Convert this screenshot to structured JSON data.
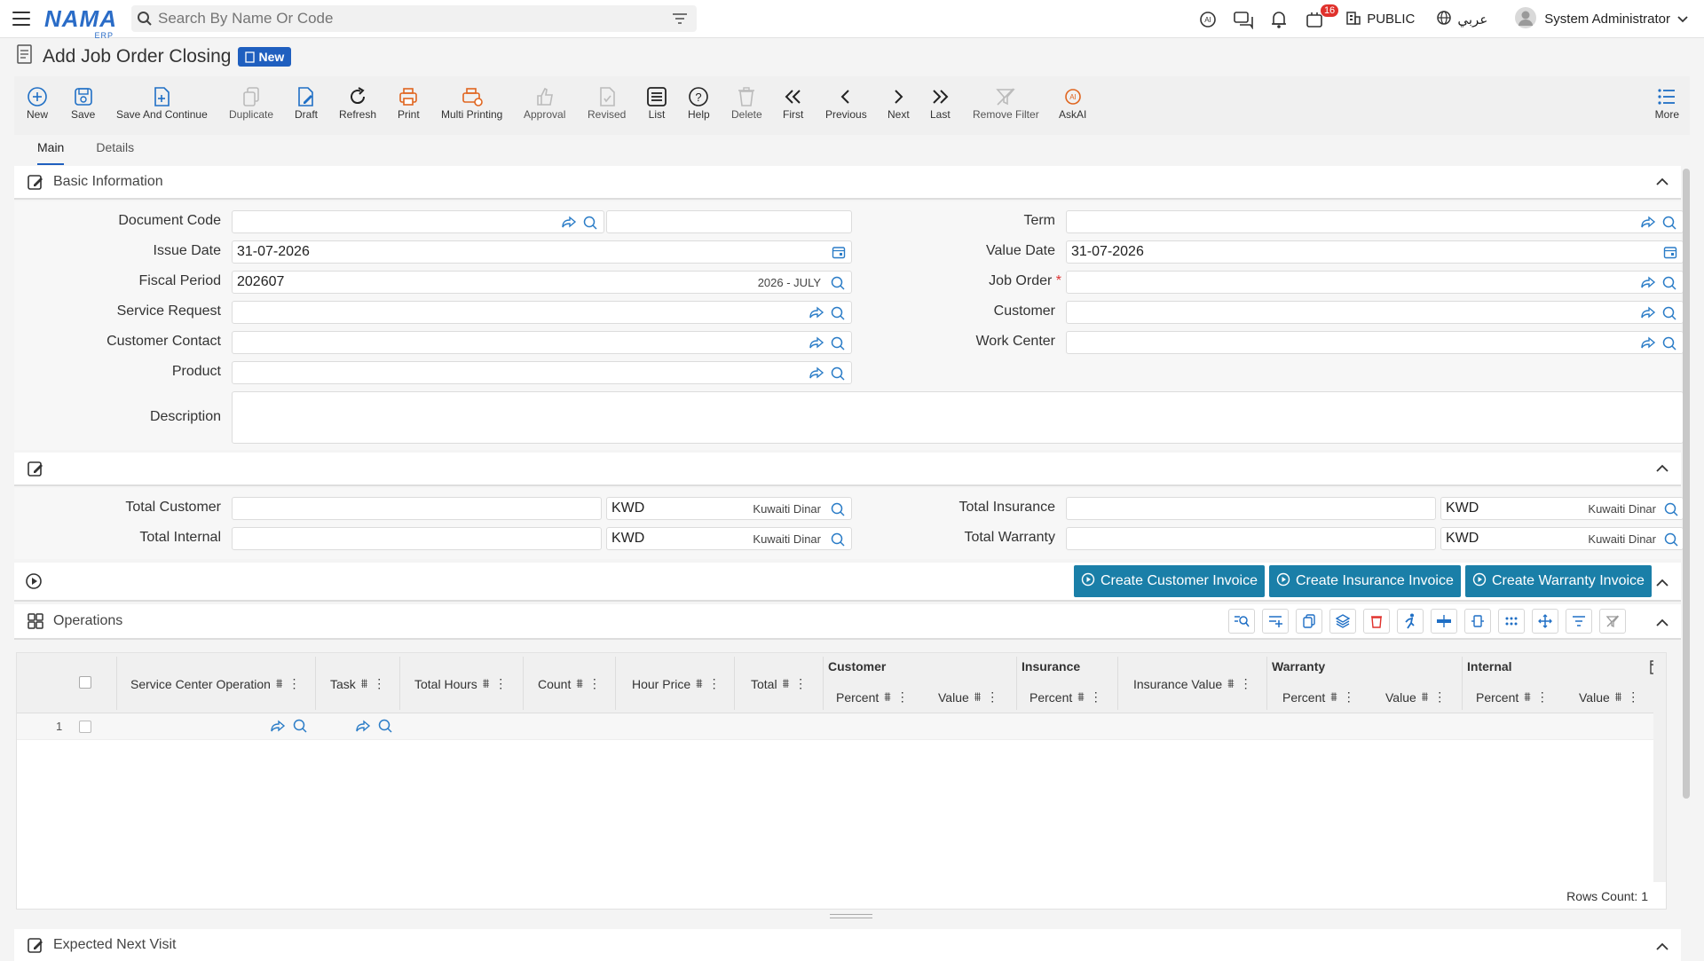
{
  "app": {
    "logo": "NAMA",
    "logo_sub": "ERP"
  },
  "search": {
    "placeholder": "Search By Name Or Code"
  },
  "topbar": {
    "notifications_count": "16",
    "public_label": "PUBLIC",
    "language_label": "عربي",
    "user_name": "System Administrator"
  },
  "page": {
    "title": "Add Job Order Closing",
    "badge": "New"
  },
  "toolbar": {
    "items": [
      "New",
      "Save",
      "Save And Continue",
      "Duplicate",
      "Draft",
      "Refresh",
      "Print",
      "Multi Printing",
      "Approval",
      "Revised",
      "List",
      "Help",
      "Delete",
      "First",
      "Previous",
      "Next",
      "Last",
      "Remove Filter",
      "AskAI",
      "More"
    ]
  },
  "tabs": [
    "Main",
    "Details"
  ],
  "basic": {
    "section_title": "Basic Information",
    "document_code": "Document Code",
    "issue_date": "Issue Date",
    "issue_date_value": "31-07-2026",
    "fiscal_period": "Fiscal Period",
    "fiscal_period_value": "202607",
    "fiscal_period_desc": "2026 - JULY",
    "service_request": "Service Request",
    "customer_contact": "Customer Contact",
    "product": "Product",
    "description": "Description",
    "term": "Term",
    "value_date": "Value Date",
    "value_date_value": "31-07-2026",
    "job_order": "Job Order",
    "required_mark": "*",
    "customer": "Customer",
    "work_center": "Work Center"
  },
  "totals": {
    "total_customer": "Total Customer",
    "total_internal": "Total Internal",
    "total_insurance": "Total Insurance",
    "total_warranty": "Total Warranty",
    "currency_code": "KWD",
    "currency_name": "Kuwaiti Dinar"
  },
  "actions": {
    "customer_invoice": "Create Customer Invoice",
    "insurance_invoice": "Create Insurance Invoice",
    "warranty_invoice": "Create Warranty Invoice"
  },
  "operations": {
    "section_title": "Operations",
    "columns": {
      "service_center_operation": "Service Center Operation",
      "task": "Task",
      "total_hours": "Total Hours",
      "count": "Count",
      "hour_price": "Hour Price",
      "total": "Total",
      "customer": "Customer",
      "insurance": "Insurance",
      "insurance_value": "Insurance Value",
      "warranty": "Warranty",
      "internal": "Internal",
      "percent": "Percent",
      "value": "Value"
    },
    "row_number": "1",
    "rows_count": "Rows Count: 1"
  },
  "next_section": {
    "title": "Expected Next Visit"
  }
}
